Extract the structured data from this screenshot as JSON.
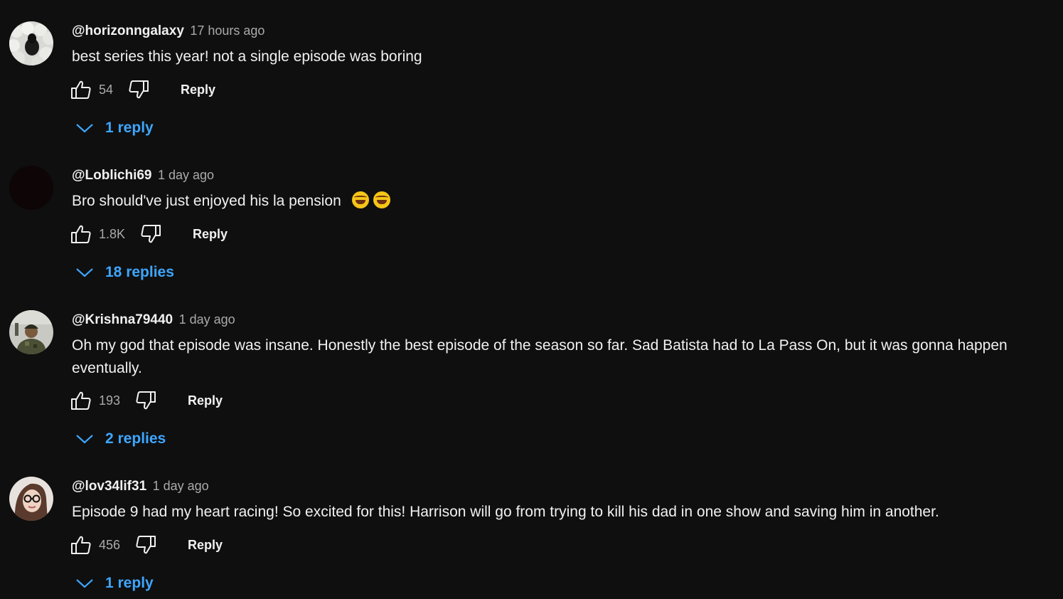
{
  "comments": [
    {
      "author": "@horizonngalaxy",
      "time": "17 hours ago",
      "text": "best series this year! not a single episode was boring",
      "likes": "54",
      "reply_label": "Reply",
      "replies_label": "1 reply",
      "avatar_icon": "sheep-avatar-icon"
    },
    {
      "author": "@Loblichi69",
      "time": "1 day ago",
      "text": "Bro should've just enjoyed his la pension",
      "emoji": [
        "face-with-tears-of-joy",
        "face-with-tears-of-joy"
      ],
      "likes": "1.8K",
      "reply_label": "Reply",
      "replies_label": "18 replies",
      "avatar_icon": "dark-avatar-icon"
    },
    {
      "author": "@Krishna79440",
      "time": "1 day ago",
      "text": "Oh my god that episode was insane. Honestly the best episode of the season so far. Sad Batista had to La Pass On, but it was gonna happen eventually.",
      "likes": "193",
      "reply_label": "Reply",
      "replies_label": "2 replies",
      "avatar_icon": "soldier-avatar-icon"
    },
    {
      "author": "@lov34lif31",
      "time": "1 day ago",
      "text": "Episode 9 had my heart racing! So excited for this!  Harrison will go from trying to kill his dad in one show and saving him in another.",
      "likes": "456",
      "reply_label": "Reply",
      "replies_label": "1 reply",
      "avatar_icon": "woman-glasses-avatar-icon"
    }
  ],
  "colors": {
    "background": "#0f0f0f",
    "text": "#f1f1f1",
    "muted": "#aaaaaa",
    "link": "#3ea6ff"
  }
}
